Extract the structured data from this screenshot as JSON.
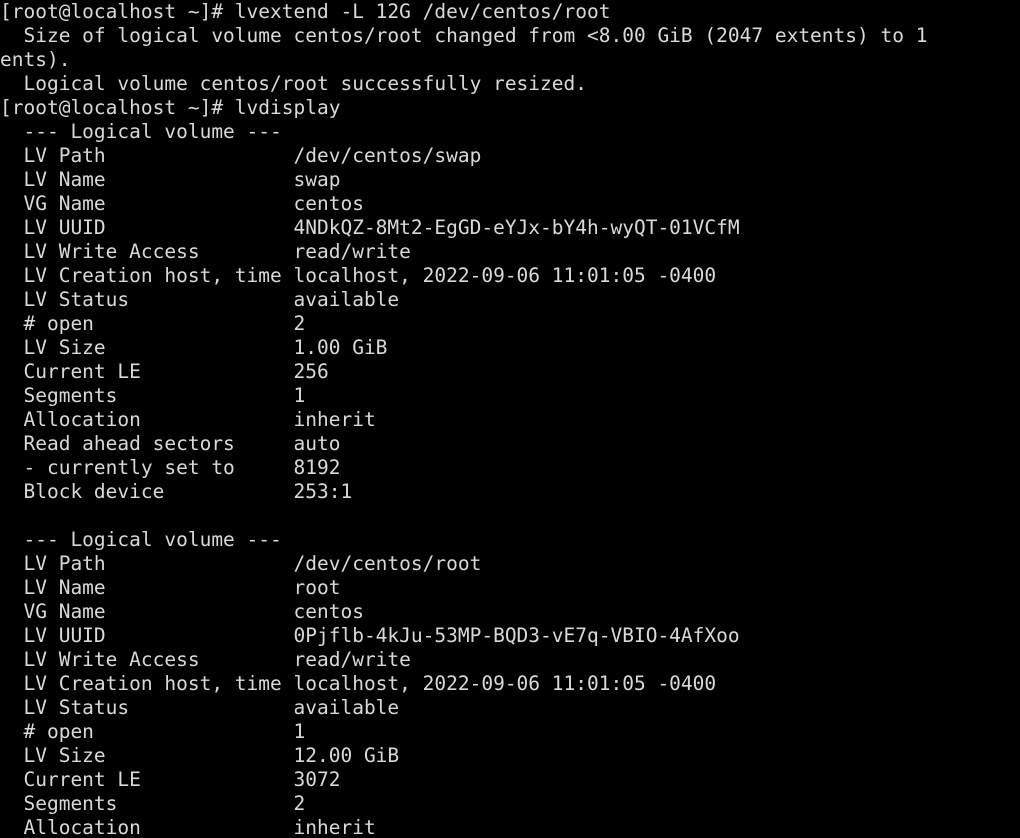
{
  "terminal": {
    "shell_prompt": "[root@localhost ~]#",
    "background_color": "#000000",
    "foreground_color": "#d9d9d9",
    "columns": 79,
    "rows": 35,
    "lines": [
      "[root@localhost ~]# lvextend -L 12G /dev/centos/root",
      "  Size of logical volume centos/root changed from <8.00 GiB (2047 extents) to 1",
      "ents).",
      "  Logical volume centos/root successfully resized.",
      "[root@localhost ~]# lvdisplay",
      "  --- Logical volume ---",
      "  LV Path                /dev/centos/swap",
      "  LV Name                swap",
      "  VG Name                centos",
      "  LV UUID                4NDkQZ-8Mt2-EgGD-eYJx-bY4h-wyQT-01VCfM",
      "  LV Write Access        read/write",
      "  LV Creation host, time localhost, 2022-09-06 11:01:05 -0400",
      "  LV Status              available",
      "  # open                 2",
      "  LV Size                1.00 GiB",
      "  Current LE             256",
      "  Segments               1",
      "  Allocation             inherit",
      "  Read ahead sectors     auto",
      "  - currently set to     8192",
      "  Block device           253:1",
      "",
      "  --- Logical volume ---",
      "  LV Path                /dev/centos/root",
      "  LV Name                root",
      "  VG Name                centos",
      "  LV UUID                0Pjflb-4kJu-53MP-BQD3-vE7q-VBIO-4AfXoo",
      "  LV Write Access        read/write",
      "  LV Creation host, time localhost, 2022-09-06 11:01:05 -0400",
      "  LV Status              available",
      "  # open                 1",
      "  LV Size                12.00 GiB",
      "  Current LE             3072",
      "  Segments               2",
      "  Allocation             inherit"
    ],
    "commands": [
      {
        "index": 0,
        "prompt": "[root@localhost ~]#",
        "command": "lvextend -L 12G /dev/centos/root"
      },
      {
        "index": 1,
        "prompt": "[root@localhost ~]#",
        "command": "lvdisplay"
      }
    ],
    "lvextend_output": {
      "size_change": "  Size of logical volume centos/root changed from <8.00 GiB (2047 extents) to 1",
      "size_change_wrap": "ents).",
      "success": "  Logical volume centos/root successfully resized."
    },
    "logical_volumes": [
      {
        "header": "  --- Logical volume ---",
        "fields": [
          {
            "label": "LV Path",
            "value": "/dev/centos/swap"
          },
          {
            "label": "LV Name",
            "value": "swap"
          },
          {
            "label": "VG Name",
            "value": "centos"
          },
          {
            "label": "LV UUID",
            "value": "4NDkQZ-8Mt2-EgGD-eYJx-bY4h-wyQT-01VCfM"
          },
          {
            "label": "LV Write Access",
            "value": "read/write"
          },
          {
            "label": "LV Creation host, time",
            "value": "localhost, 2022-09-06 11:01:05 -0400"
          },
          {
            "label": "LV Status",
            "value": "available"
          },
          {
            "label": "# open",
            "value": "2"
          },
          {
            "label": "LV Size",
            "value": "1.00 GiB"
          },
          {
            "label": "Current LE",
            "value": "256"
          },
          {
            "label": "Segments",
            "value": "1"
          },
          {
            "label": "Allocation",
            "value": "inherit"
          },
          {
            "label": "Read ahead sectors",
            "value": "auto"
          },
          {
            "label": "- currently set to",
            "value": "8192"
          },
          {
            "label": "Block device",
            "value": "253:1"
          }
        ]
      },
      {
        "header": "  --- Logical volume ---",
        "fields": [
          {
            "label": "LV Path",
            "value": "/dev/centos/root"
          },
          {
            "label": "LV Name",
            "value": "root"
          },
          {
            "label": "VG Name",
            "value": "centos"
          },
          {
            "label": "LV UUID",
            "value": "0Pjflb-4kJu-53MP-BQD3-vE7q-VBIO-4AfXoo"
          },
          {
            "label": "LV Write Access",
            "value": "read/write"
          },
          {
            "label": "LV Creation host, time",
            "value": "localhost, 2022-09-06 11:01:05 -0400"
          },
          {
            "label": "LV Status",
            "value": "available"
          },
          {
            "label": "# open",
            "value": "1"
          },
          {
            "label": "LV Size",
            "value": "12.00 GiB"
          },
          {
            "label": "Current LE",
            "value": "3072"
          },
          {
            "label": "Segments",
            "value": "2"
          },
          {
            "label": "Allocation",
            "value": "inherit"
          }
        ]
      }
    ]
  }
}
